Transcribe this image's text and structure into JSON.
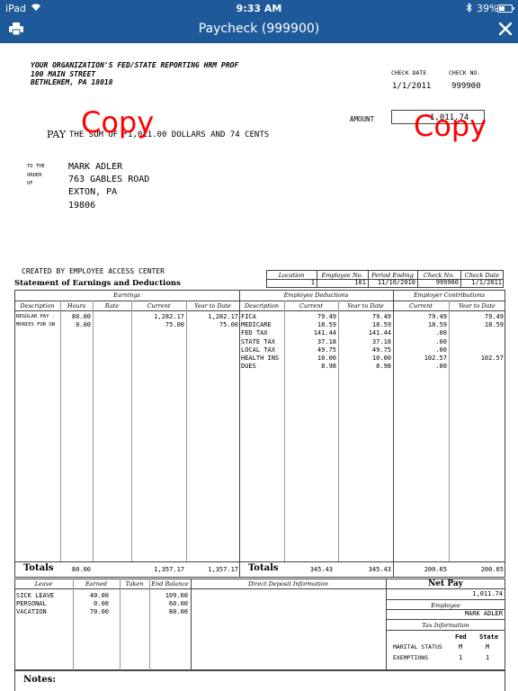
{
  "status_bar": {
    "device": "iPad",
    "time": "9:33 AM",
    "battery": "39%"
  },
  "nav": {
    "title": "Paycheck (999900)",
    "print_icon": "printer-icon",
    "close_icon": "close-icon"
  },
  "colors": {
    "nav_bg": "#1e5a99",
    "copy_mark": "#ff0000"
  },
  "check": {
    "org_lines": [
      "YOUR ORGANIZATION'S FED/STATE REPORTING HRM PROF",
      "100 MAIN STREET",
      "BETHLEHEM, PA 18018"
    ],
    "check_date_label": "CHECK DATE",
    "check_no_label": "CHECK NO.",
    "check_date": "1/1/2011",
    "check_no": "999900",
    "amount_label": "AMOUNT",
    "amount": "1,011.74",
    "pay_label": "PAY",
    "pay_text": "THE SUM OF *1,011.00 DOLLARS AND 74 CENTS",
    "copy_mark": "Copy",
    "to_the_order_of": [
      "TO THE",
      "ORDER",
      "OF"
    ],
    "payee_lines": [
      "MARK ADLER",
      "763 GABLES ROAD",
      "EXTON, PA",
      "19806"
    ]
  },
  "stub": {
    "created_by": "CREATED BY EMPLOYEE ACCESS CENTER",
    "statement_title": "Statement of Earnings and Deductions",
    "info_headers": [
      "Location",
      "Employee No.",
      "Period Ending",
      "Check No.",
      "Check Date"
    ],
    "info_values": [
      "1",
      "101",
      "11/10/2010",
      "999900",
      "1/1/2011"
    ],
    "earnings_label": "Earnings",
    "emp_deductions_label": "Employee Deductions",
    "employer_contrib_label": "Employer Contributions",
    "earnings_headers": [
      "Description",
      "Hours",
      "Rate",
      "Current",
      "Year to Date"
    ],
    "deduction_headers": [
      "Description",
      "Current",
      "Year to Date"
    ],
    "contrib_headers": [
      "Current",
      "Year to Date"
    ],
    "earnings_rows": [
      {
        "desc": "REGULAR PAY -",
        "hours": "80.00",
        "rate": "",
        "current": "1,282.17",
        "ytd": "1,282.17"
      },
      {
        "desc": "MONIES FOR UN",
        "hours": "0.00",
        "rate": "",
        "current": "75.00",
        "ytd": "75.00"
      }
    ],
    "deduction_rows": [
      {
        "desc": "FICA",
        "current": "79.49",
        "ytd": "79.49",
        "er_current": "79.49",
        "er_ytd": "79.49"
      },
      {
        "desc": "MEDICARE",
        "current": "18.59",
        "ytd": "18.59",
        "er_current": "18.59",
        "er_ytd": "18.59"
      },
      {
        "desc": "FED TAX",
        "current": "141.44",
        "ytd": "141.44",
        "er_current": ".00",
        "er_ytd": ""
      },
      {
        "desc": "STATE TAX",
        "current": "37.18",
        "ytd": "37.18",
        "er_current": ".00",
        "er_ytd": ""
      },
      {
        "desc": "LOCAL TAX",
        "current": "49.75",
        "ytd": "49.75",
        "er_current": ".00",
        "er_ytd": ""
      },
      {
        "desc": "HEALTH INS",
        "current": "10.00",
        "ytd": "10.00",
        "er_current": "102.57",
        "er_ytd": "102.57"
      },
      {
        "desc": "DUES",
        "current": "8.98",
        "ytd": "8.98",
        "er_current": ".00",
        "er_ytd": ""
      }
    ],
    "totals_label": "Totals",
    "earnings_totals": {
      "hours": "80.00",
      "current": "1,357.17",
      "ytd": "1,357.17"
    },
    "deduction_totals": {
      "current": "345.43",
      "ytd": "345.43",
      "er_current": "200.65",
      "er_ytd": "200.65"
    },
    "leave_headers": [
      "Leave",
      "Earned",
      "Taken",
      "End Balance"
    ],
    "leave_rows": [
      {
        "type": "SICK LEAVE",
        "earned": "40.00",
        "taken": "",
        "balance": "109.00"
      },
      {
        "type": "PERSONAL",
        "earned": "0.00",
        "taken": "",
        "balance": "60.00"
      },
      {
        "type": "VACATION",
        "earned": "70.00",
        "taken": "",
        "balance": "80.00"
      }
    ],
    "direct_deposit_label": "Direct Deposit Information",
    "net_pay_label": "Net Pay",
    "net_pay": "1,011.74",
    "employee_label": "Employee",
    "employee_name": "MARK ADLER",
    "tax_info_label": "Tax Information",
    "tax_fed_label": "Fed",
    "tax_state_label": "State",
    "marital_label": "MARITAL STATUS",
    "marital_fed": "M",
    "marital_state": "M",
    "exemptions_label": "EXEMPTIONS",
    "exemptions_fed": "1",
    "exemptions_state": "1",
    "notes_label": "Notes:"
  }
}
